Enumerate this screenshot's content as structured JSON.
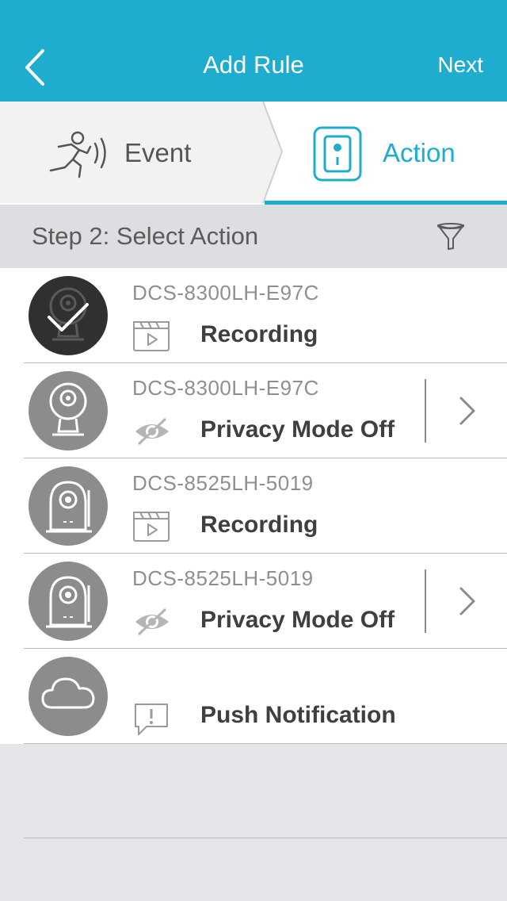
{
  "header": {
    "title": "Add Rule",
    "next_label": "Next"
  },
  "tabs": [
    {
      "label": "Event",
      "icon": "running-person-motion-icon",
      "active": false
    },
    {
      "label": "Action",
      "icon": "camera-device-icon",
      "active": true
    }
  ],
  "step": {
    "label": "Step 2: Select Action"
  },
  "actions": [
    {
      "device": "DCS-8300LH-E97C",
      "action": "Recording",
      "action_icon": "clapperboard-icon",
      "device_icon": "dome-camera-icon",
      "selected": true,
      "has_settings": false
    },
    {
      "device": "DCS-8300LH-E97C",
      "action": "Privacy Mode Off",
      "action_icon": "eye-slash-icon",
      "device_icon": "dome-camera-icon",
      "selected": false,
      "has_settings": true
    },
    {
      "device": "DCS-8525LH-5019",
      "action": "Recording",
      "action_icon": "clapperboard-icon",
      "device_icon": "pan-tilt-camera-icon",
      "selected": false,
      "has_settings": false
    },
    {
      "device": "DCS-8525LH-5019",
      "action": "Privacy Mode Off",
      "action_icon": "eye-slash-icon",
      "device_icon": "pan-tilt-camera-icon",
      "selected": false,
      "has_settings": true
    },
    {
      "device": "",
      "action": "Push Notification",
      "action_icon": "alert-bubble-icon",
      "device_icon": "cloud-icon",
      "selected": false,
      "has_settings": false
    }
  ],
  "colors": {
    "accent": "#1eaccf",
    "avatar": "#8c8c8c",
    "avatar_selected": "#303030"
  }
}
